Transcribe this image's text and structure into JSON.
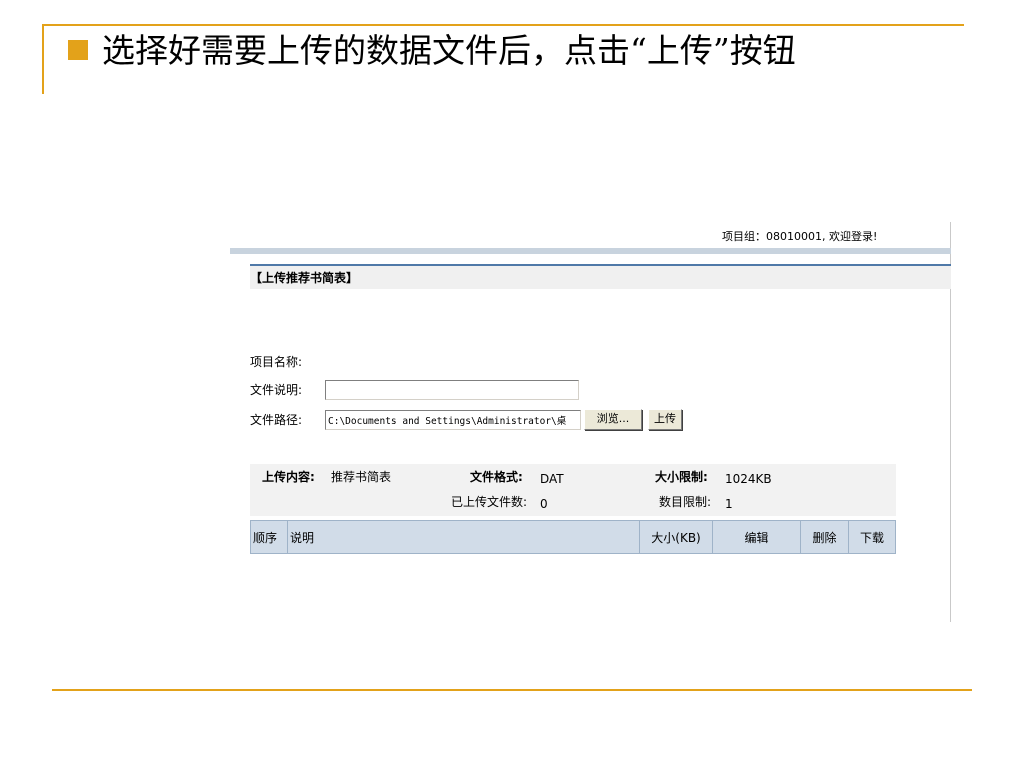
{
  "slide": {
    "heading": "选择好需要上传的数据文件后，点击“上传”按钮",
    "accent_color": "#e3a21a"
  },
  "app": {
    "welcome_text": "项目组：08010001, 欢迎登录!",
    "section_title": "【上传推荐书简表】",
    "form": {
      "project_name_label": "项目名称:",
      "file_desc_label": "文件说明:",
      "file_desc_value": "",
      "file_path_label": "文件路径:",
      "file_path_value": "C:\\Documents and Settings\\Administrator\\桌",
      "browse_button": "浏览...",
      "upload_button": "上传"
    },
    "info": {
      "content_label": "上传内容:",
      "content_value": "推荐书简表",
      "format_label": "文件格式:",
      "format_value": "DAT",
      "size_limit_label": "大小限制:",
      "size_limit_value": "1024KB",
      "uploaded_count_label": "已上传文件数:",
      "uploaded_count_value": "0",
      "count_limit_label": "数目限制:",
      "count_limit_value": "1"
    },
    "table": {
      "columns": [
        "顺序",
        "说明",
        "大小(KB)",
        "编辑",
        "删除",
        "下载"
      ],
      "rows": []
    }
  }
}
